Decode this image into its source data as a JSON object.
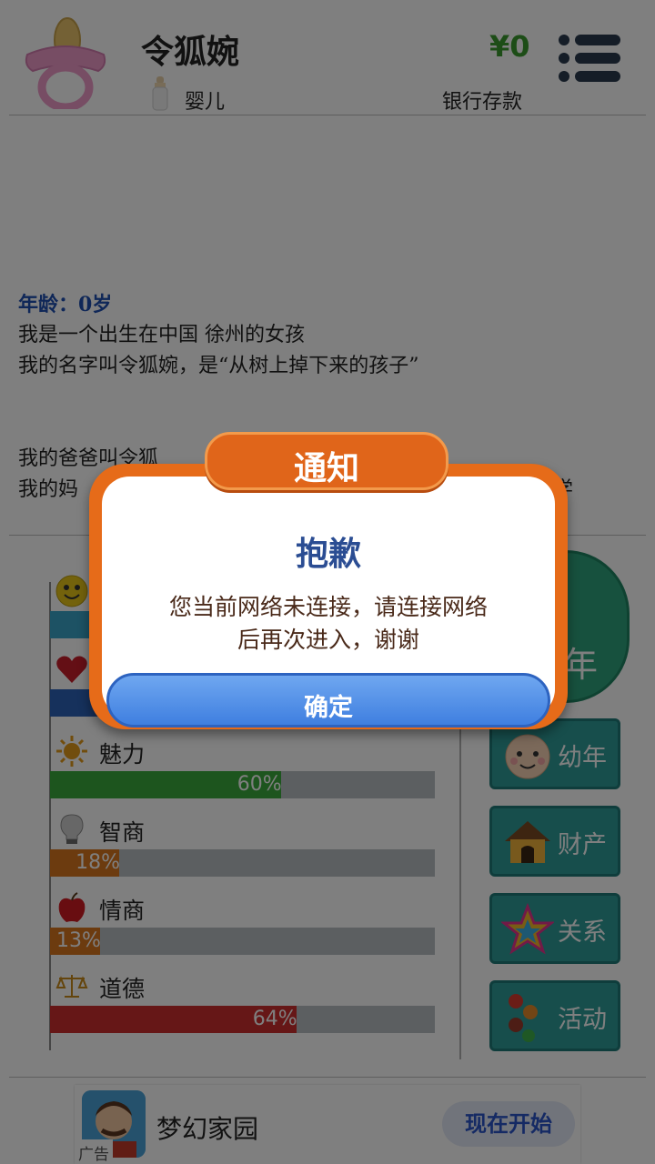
{
  "header": {
    "name": "令狐婉",
    "stage": "婴儿",
    "money": "¥0",
    "bank_label": "银行存款"
  },
  "story": {
    "age_line": "年龄：0岁",
    "line1": "我是一个出生在中国 徐州的女孩",
    "line2": "我的名字叫令狐婉，是“从树上掉下来的孩子”",
    "line3": "我的爸爸叫令狐",
    "line4_start": "我的妈",
    "line4_end": "学"
  },
  "attributes": [
    {
      "label": "",
      "icon": "happy-face-icon",
      "value": 0,
      "text": "",
      "color": "#3ba5c9"
    },
    {
      "label": "",
      "icon": "heart-icon",
      "value": 0,
      "text": "",
      "color": "#2d63b8"
    },
    {
      "label": "魅力",
      "icon": "sun-icon",
      "value": 60,
      "text": "60%",
      "color": "#3bab3d"
    },
    {
      "label": "智商",
      "icon": "lightbulb-icon",
      "value": 18,
      "text": "18%",
      "color": "#d9761f"
    },
    {
      "label": "情商",
      "icon": "apple-icon",
      "value": 13,
      "text": "13%",
      "color": "#d9761f"
    },
    {
      "label": "道德",
      "icon": "scales-icon",
      "value": 64,
      "text": "64%",
      "color": "#cc2f2f"
    }
  ],
  "side": {
    "next_year": "年",
    "buttons": [
      {
        "label": "幼年",
        "icon": "baby-face-icon"
      },
      {
        "label": "财产",
        "icon": "house-icon"
      },
      {
        "label": "关系",
        "icon": "star-icon"
      },
      {
        "label": "活动",
        "icon": "dots-icon"
      }
    ]
  },
  "ad": {
    "title": "梦幻家园",
    "badge": "广告",
    "cta": "现在开始"
  },
  "dialog": {
    "tab": "通知",
    "title": "抱歉",
    "message_line1": "您当前网络未连接，请连接网络",
    "message_line2": "后再次进入，谢谢",
    "confirm": "确定"
  }
}
